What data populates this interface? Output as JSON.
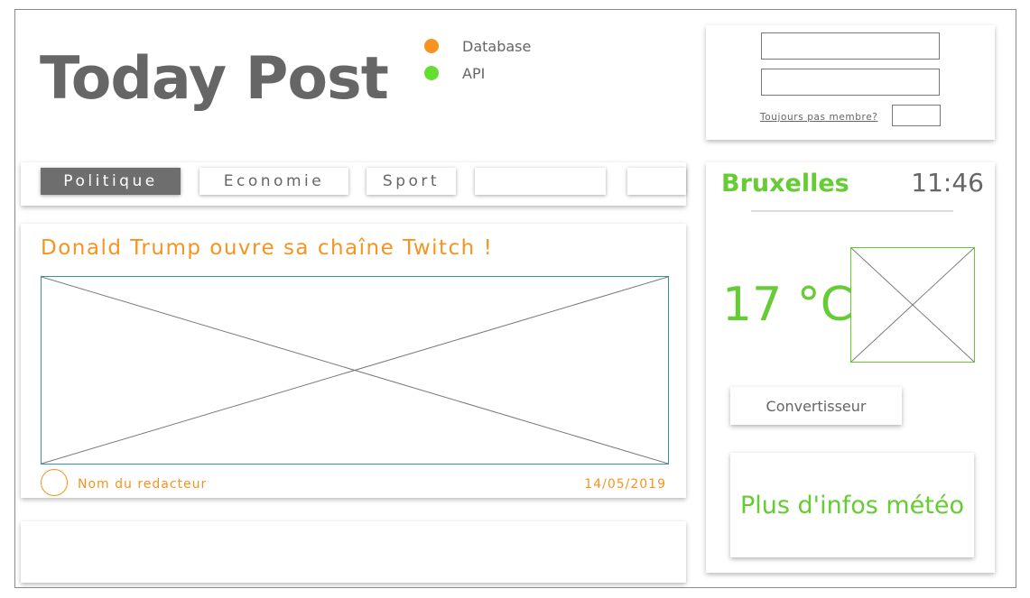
{
  "header": {
    "title": "Today Post",
    "status": [
      {
        "label": "Database",
        "color": "#f7931e"
      },
      {
        "label": "API",
        "color": "#66dd33"
      }
    ]
  },
  "login": {
    "username_value": "",
    "password_value": "",
    "member_link": "Toujours pas membre?"
  },
  "nav": {
    "tabs": [
      {
        "label": "Politique",
        "active": true
      },
      {
        "label": "Economie",
        "active": false
      },
      {
        "label": "Sport",
        "active": false
      },
      {
        "label": "",
        "active": false
      },
      {
        "label": "",
        "active": false
      }
    ]
  },
  "article": {
    "headline": "Donald Trump ouvre sa chaîne Twitch !",
    "author": "Nom du redacteur",
    "date": "14/05/2019",
    "image_icon": "image-placeholder-icon"
  },
  "weather": {
    "city": "Bruxelles",
    "time": "11:46",
    "temperature": "17 °C",
    "icon": "weather-placeholder-icon",
    "converter_label": "Convertisseur",
    "more_label": "Plus d'infos météo"
  },
  "colors": {
    "accent_orange": "#f7931e",
    "accent_green": "#66cc33",
    "text_gray": "#666666"
  }
}
